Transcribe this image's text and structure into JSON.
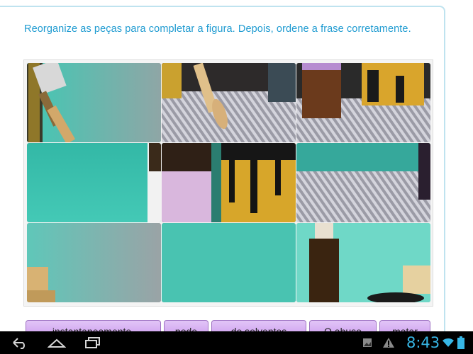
{
  "instruction": "Reorganize as peças para completar a figura. Depois, ordene a frase corretamente.",
  "words": [
    {
      "label": "instantaneamente."
    },
    {
      "label": "pode"
    },
    {
      "label": "de solventes"
    },
    {
      "label": "O abuso"
    },
    {
      "label": "matar"
    }
  ],
  "clock": "8:43",
  "colors": {
    "accent": "#1f9bd1",
    "chip": "#d6b0f3",
    "teal": "#3fc2b2",
    "clock": "#37b7e6"
  },
  "icons": [
    "back-icon",
    "home-icon",
    "recent-apps-icon",
    "gallery-notification-icon",
    "warning-icon",
    "wifi-icon",
    "battery-icon"
  ]
}
